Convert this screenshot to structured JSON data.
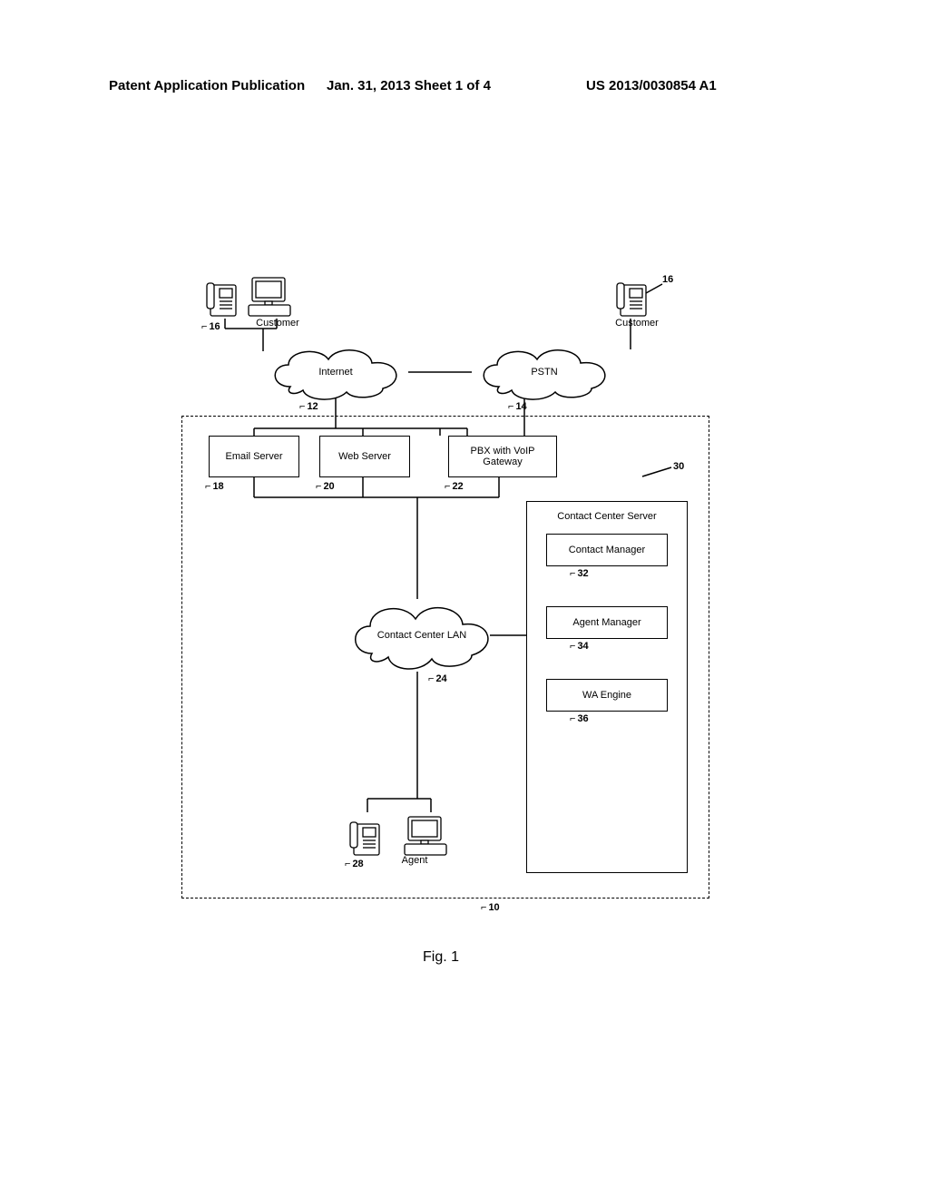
{
  "header": {
    "left": "Patent Application Publication",
    "center": "Jan. 31, 2013   Sheet 1 of 4",
    "right": "US 2013/0030854 A1"
  },
  "figure_caption": "Fig. 1",
  "clouds": {
    "internet": "Internet",
    "pstn": "PSTN",
    "lan": "Contact Center LAN"
  },
  "boxes": {
    "email_server": "Email Server",
    "web_server": "Web Server",
    "pbx": "PBX with VoIP Gateway",
    "cc_server": "Contact Center Server",
    "contact_mgr": "Contact Manager",
    "agent_mgr": "Agent Manager",
    "wa_engine": "WA Engine"
  },
  "stations": {
    "customer_left": "Customer",
    "customer_right": "Customer",
    "agent": "Agent"
  },
  "refs": {
    "r10": "10",
    "r12": "12",
    "r14": "14",
    "r16a": "16",
    "r16b": "16",
    "r18": "18",
    "r20": "20",
    "r22": "22",
    "r24": "24",
    "r28": "28",
    "r30": "30",
    "r32": "32",
    "r34": "34",
    "r36": "36"
  },
  "chart_data": {
    "type": "diagram",
    "title": "Fig. 1",
    "nodes": [
      {
        "id": "customer_left",
        "label": "Customer",
        "ref": 16,
        "kind": "workstation"
      },
      {
        "id": "customer_right",
        "label": "Customer",
        "ref": 16,
        "kind": "workstation"
      },
      {
        "id": "internet",
        "label": "Internet",
        "ref": 12,
        "kind": "cloud"
      },
      {
        "id": "pstn",
        "label": "PSTN",
        "ref": 14,
        "kind": "cloud"
      },
      {
        "id": "email_server",
        "label": "Email Server",
        "ref": 18,
        "kind": "box"
      },
      {
        "id": "web_server",
        "label": "Web Server",
        "ref": 20,
        "kind": "box"
      },
      {
        "id": "pbx",
        "label": "PBX with VoIP Gateway",
        "ref": 22,
        "kind": "box"
      },
      {
        "id": "lan",
        "label": "Contact Center LAN",
        "ref": 24,
        "kind": "cloud"
      },
      {
        "id": "agent",
        "label": "Agent",
        "ref": 28,
        "kind": "workstation"
      },
      {
        "id": "cc_server",
        "label": "Contact Center Server",
        "ref": 30,
        "kind": "container"
      },
      {
        "id": "contact_mgr",
        "label": "Contact Manager",
        "ref": 32,
        "kind": "box",
        "parent": "cc_server"
      },
      {
        "id": "agent_mgr",
        "label": "Agent Manager",
        "ref": 34,
        "kind": "box",
        "parent": "cc_server"
      },
      {
        "id": "wa_engine",
        "label": "WA Engine",
        "ref": 36,
        "kind": "box",
        "parent": "cc_server"
      },
      {
        "id": "system",
        "label": "",
        "ref": 10,
        "kind": "boundary"
      }
    ],
    "edges": [
      [
        "customer_left",
        "internet"
      ],
      [
        "customer_right",
        "pstn"
      ],
      [
        "internet",
        "pstn"
      ],
      [
        "internet",
        "email_server"
      ],
      [
        "internet",
        "web_server"
      ],
      [
        "internet",
        "pbx"
      ],
      [
        "pstn",
        "pbx"
      ],
      [
        "email_server",
        "lan"
      ],
      [
        "web_server",
        "lan"
      ],
      [
        "pbx",
        "lan"
      ],
      [
        "lan",
        "cc_server"
      ],
      [
        "lan",
        "agent"
      ]
    ]
  }
}
